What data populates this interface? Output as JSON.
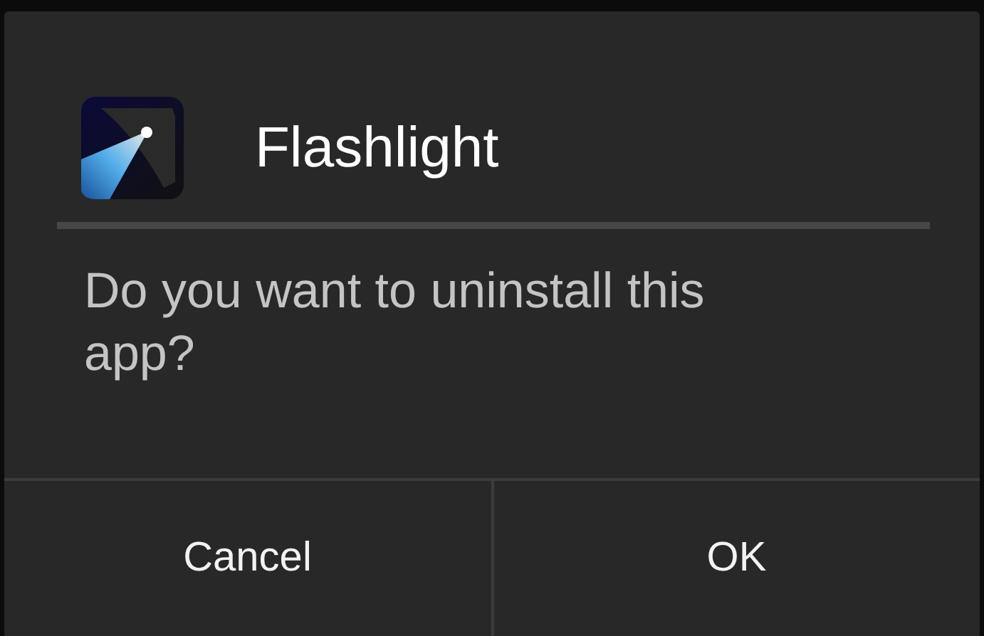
{
  "dialog": {
    "title": "Flashlight",
    "message": "Do you want to uninstall this app?",
    "buttons": [
      "Cancel",
      "OK"
    ]
  }
}
